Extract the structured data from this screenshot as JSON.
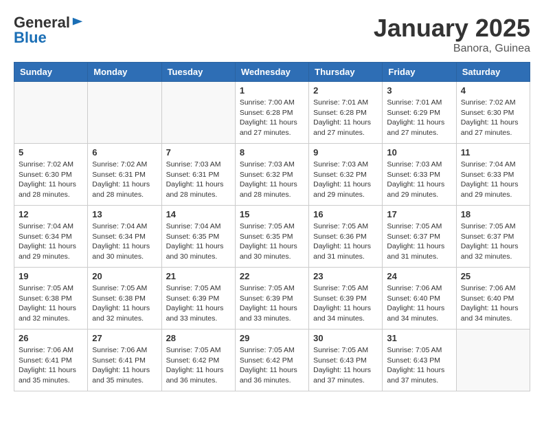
{
  "header": {
    "logo_general": "General",
    "logo_blue": "Blue",
    "month_title": "January 2025",
    "location": "Banora, Guinea"
  },
  "days_of_week": [
    "Sunday",
    "Monday",
    "Tuesday",
    "Wednesday",
    "Thursday",
    "Friday",
    "Saturday"
  ],
  "weeks": [
    [
      {
        "day": "",
        "info": ""
      },
      {
        "day": "",
        "info": ""
      },
      {
        "day": "",
        "info": ""
      },
      {
        "day": "1",
        "info": "Sunrise: 7:00 AM\nSunset: 6:28 PM\nDaylight: 11 hours\nand 27 minutes."
      },
      {
        "day": "2",
        "info": "Sunrise: 7:01 AM\nSunset: 6:28 PM\nDaylight: 11 hours\nand 27 minutes."
      },
      {
        "day": "3",
        "info": "Sunrise: 7:01 AM\nSunset: 6:29 PM\nDaylight: 11 hours\nand 27 minutes."
      },
      {
        "day": "4",
        "info": "Sunrise: 7:02 AM\nSunset: 6:30 PM\nDaylight: 11 hours\nand 27 minutes."
      }
    ],
    [
      {
        "day": "5",
        "info": "Sunrise: 7:02 AM\nSunset: 6:30 PM\nDaylight: 11 hours\nand 28 minutes."
      },
      {
        "day": "6",
        "info": "Sunrise: 7:02 AM\nSunset: 6:31 PM\nDaylight: 11 hours\nand 28 minutes."
      },
      {
        "day": "7",
        "info": "Sunrise: 7:03 AM\nSunset: 6:31 PM\nDaylight: 11 hours\nand 28 minutes."
      },
      {
        "day": "8",
        "info": "Sunrise: 7:03 AM\nSunset: 6:32 PM\nDaylight: 11 hours\nand 28 minutes."
      },
      {
        "day": "9",
        "info": "Sunrise: 7:03 AM\nSunset: 6:32 PM\nDaylight: 11 hours\nand 29 minutes."
      },
      {
        "day": "10",
        "info": "Sunrise: 7:03 AM\nSunset: 6:33 PM\nDaylight: 11 hours\nand 29 minutes."
      },
      {
        "day": "11",
        "info": "Sunrise: 7:04 AM\nSunset: 6:33 PM\nDaylight: 11 hours\nand 29 minutes."
      }
    ],
    [
      {
        "day": "12",
        "info": "Sunrise: 7:04 AM\nSunset: 6:34 PM\nDaylight: 11 hours\nand 29 minutes."
      },
      {
        "day": "13",
        "info": "Sunrise: 7:04 AM\nSunset: 6:34 PM\nDaylight: 11 hours\nand 30 minutes."
      },
      {
        "day": "14",
        "info": "Sunrise: 7:04 AM\nSunset: 6:35 PM\nDaylight: 11 hours\nand 30 minutes."
      },
      {
        "day": "15",
        "info": "Sunrise: 7:05 AM\nSunset: 6:35 PM\nDaylight: 11 hours\nand 30 minutes."
      },
      {
        "day": "16",
        "info": "Sunrise: 7:05 AM\nSunset: 6:36 PM\nDaylight: 11 hours\nand 31 minutes."
      },
      {
        "day": "17",
        "info": "Sunrise: 7:05 AM\nSunset: 6:37 PM\nDaylight: 11 hours\nand 31 minutes."
      },
      {
        "day": "18",
        "info": "Sunrise: 7:05 AM\nSunset: 6:37 PM\nDaylight: 11 hours\nand 32 minutes."
      }
    ],
    [
      {
        "day": "19",
        "info": "Sunrise: 7:05 AM\nSunset: 6:38 PM\nDaylight: 11 hours\nand 32 minutes."
      },
      {
        "day": "20",
        "info": "Sunrise: 7:05 AM\nSunset: 6:38 PM\nDaylight: 11 hours\nand 32 minutes."
      },
      {
        "day": "21",
        "info": "Sunrise: 7:05 AM\nSunset: 6:39 PM\nDaylight: 11 hours\nand 33 minutes."
      },
      {
        "day": "22",
        "info": "Sunrise: 7:05 AM\nSunset: 6:39 PM\nDaylight: 11 hours\nand 33 minutes."
      },
      {
        "day": "23",
        "info": "Sunrise: 7:05 AM\nSunset: 6:39 PM\nDaylight: 11 hours\nand 34 minutes."
      },
      {
        "day": "24",
        "info": "Sunrise: 7:06 AM\nSunset: 6:40 PM\nDaylight: 11 hours\nand 34 minutes."
      },
      {
        "day": "25",
        "info": "Sunrise: 7:06 AM\nSunset: 6:40 PM\nDaylight: 11 hours\nand 34 minutes."
      }
    ],
    [
      {
        "day": "26",
        "info": "Sunrise: 7:06 AM\nSunset: 6:41 PM\nDaylight: 11 hours\nand 35 minutes."
      },
      {
        "day": "27",
        "info": "Sunrise: 7:06 AM\nSunset: 6:41 PM\nDaylight: 11 hours\nand 35 minutes."
      },
      {
        "day": "28",
        "info": "Sunrise: 7:05 AM\nSunset: 6:42 PM\nDaylight: 11 hours\nand 36 minutes."
      },
      {
        "day": "29",
        "info": "Sunrise: 7:05 AM\nSunset: 6:42 PM\nDaylight: 11 hours\nand 36 minutes."
      },
      {
        "day": "30",
        "info": "Sunrise: 7:05 AM\nSunset: 6:43 PM\nDaylight: 11 hours\nand 37 minutes."
      },
      {
        "day": "31",
        "info": "Sunrise: 7:05 AM\nSunset: 6:43 PM\nDaylight: 11 hours\nand 37 minutes."
      },
      {
        "day": "",
        "info": ""
      }
    ]
  ]
}
